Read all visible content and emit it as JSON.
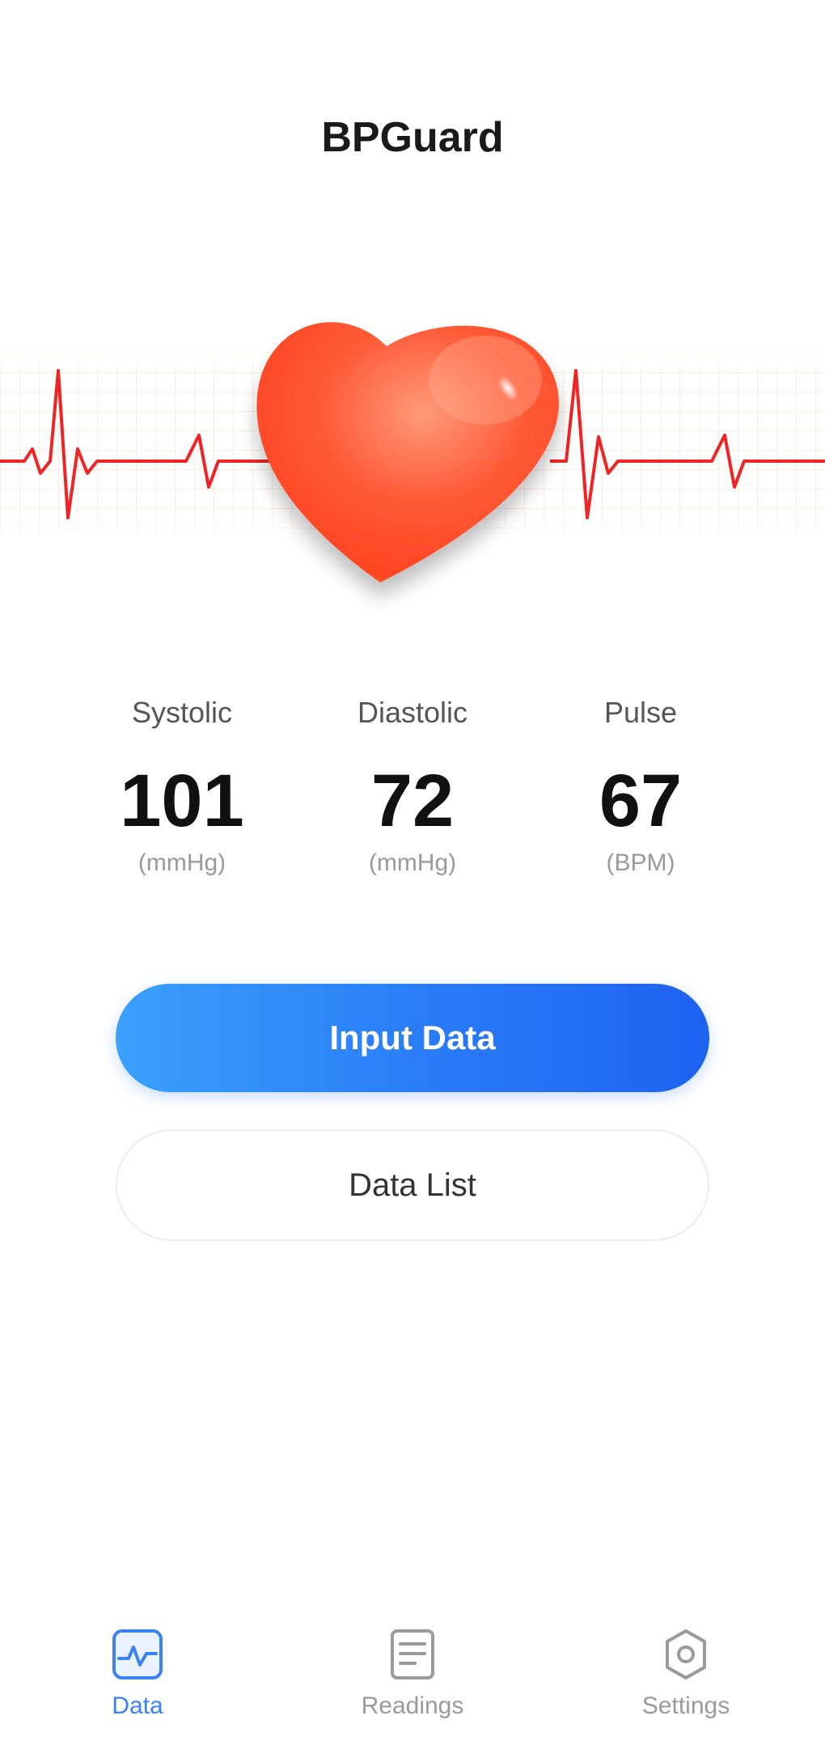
{
  "app": {
    "title": "BPGuard"
  },
  "hero": {
    "icon": "heart-icon",
    "accent": "#ff5533",
    "ecg_color": "#f02424"
  },
  "metrics": [
    {
      "label": "Systolic",
      "value": "101",
      "unit": "(mmHg)"
    },
    {
      "label": "Diastolic",
      "value": "72",
      "unit": "(mmHg)"
    },
    {
      "label": "Pulse",
      "value": "67",
      "unit": "(BPM)"
    }
  ],
  "actions": {
    "input_label": "Input Data",
    "list_label": "Data List"
  },
  "tabs": [
    {
      "label": "Data",
      "icon": "chart-icon",
      "active": true
    },
    {
      "label": "Readings",
      "icon": "document-icon",
      "active": false
    },
    {
      "label": "Settings",
      "icon": "settings-icon",
      "active": false
    }
  ],
  "colors": {
    "primary": "#2a7df7",
    "active_tab": "#3b82f6",
    "inactive_tab": "#9a9a9a"
  }
}
